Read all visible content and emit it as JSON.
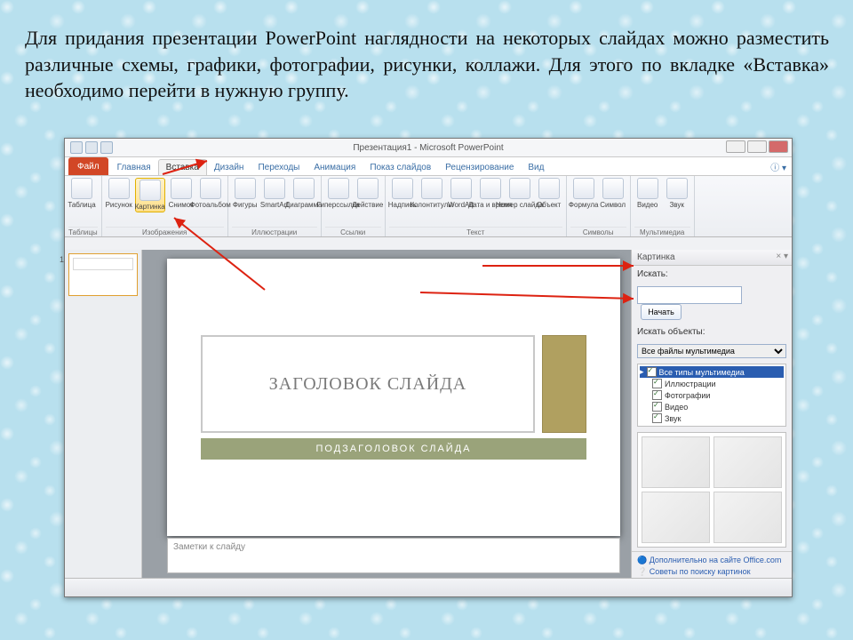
{
  "caption": "Для придания презентации PowerPoint наглядности на некоторых слайдах можно разместить различные схемы, графики, фотографии, рисунки, коллажи. Для этого по вкладке «Вставка» необходимо перейти в нужную группу.",
  "app": {
    "title": "Презентация1 - Microsoft PowerPoint"
  },
  "tabs": {
    "file": "Файл",
    "items": [
      "Главная",
      "Вставка",
      "Дизайн",
      "Переходы",
      "Анимация",
      "Показ слайдов",
      "Рецензирование",
      "Вид"
    ],
    "active": "Вставка"
  },
  "ribbon": {
    "groups": [
      {
        "label": "Таблицы",
        "icons": [
          {
            "lbl": "Таблица"
          }
        ]
      },
      {
        "label": "Изображения",
        "icons": [
          {
            "lbl": "Рисунок"
          },
          {
            "lbl": "Картинка",
            "sel": true
          },
          {
            "lbl": "Снимок"
          },
          {
            "lbl": "Фотоальбом"
          }
        ]
      },
      {
        "label": "Иллюстрации",
        "icons": [
          {
            "lbl": "Фигуры"
          },
          {
            "lbl": "SmartArt"
          },
          {
            "lbl": "Диаграмма"
          }
        ]
      },
      {
        "label": "Ссылки",
        "icons": [
          {
            "lbl": "Гиперссылка"
          },
          {
            "lbl": "Действие"
          }
        ]
      },
      {
        "label": "Текст",
        "icons": [
          {
            "lbl": "Надпись"
          },
          {
            "lbl": "Колонтитулы"
          },
          {
            "lbl": "WordArt"
          },
          {
            "lbl": "Дата и время"
          },
          {
            "lbl": "Номер слайда"
          },
          {
            "lbl": "Объект"
          }
        ]
      },
      {
        "label": "Символы",
        "icons": [
          {
            "lbl": "Формула"
          },
          {
            "lbl": "Символ"
          }
        ]
      },
      {
        "label": "Мультимедиа",
        "icons": [
          {
            "lbl": "Видео"
          },
          {
            "lbl": "Звук"
          }
        ]
      }
    ]
  },
  "slide": {
    "title": "ЗАГОЛОВОК СЛАЙДА",
    "sub": "ПОДЗАГОЛОВОК СЛАЙДА",
    "notes": "Заметки к слайду",
    "num": "1"
  },
  "panel": {
    "header": "Картинка",
    "search_label": "Искать:",
    "go": "Начать",
    "objects_label": "Искать объекты:",
    "select_value": "Все файлы мультимедиа",
    "tree": {
      "root": "Все типы мультимедиа",
      "items": [
        "Иллюстрации",
        "Фотографии",
        "Видео",
        "Звук"
      ]
    },
    "footer1": "Дополнительно на сайте Office.com",
    "footer2": "Советы по поиску картинок"
  }
}
